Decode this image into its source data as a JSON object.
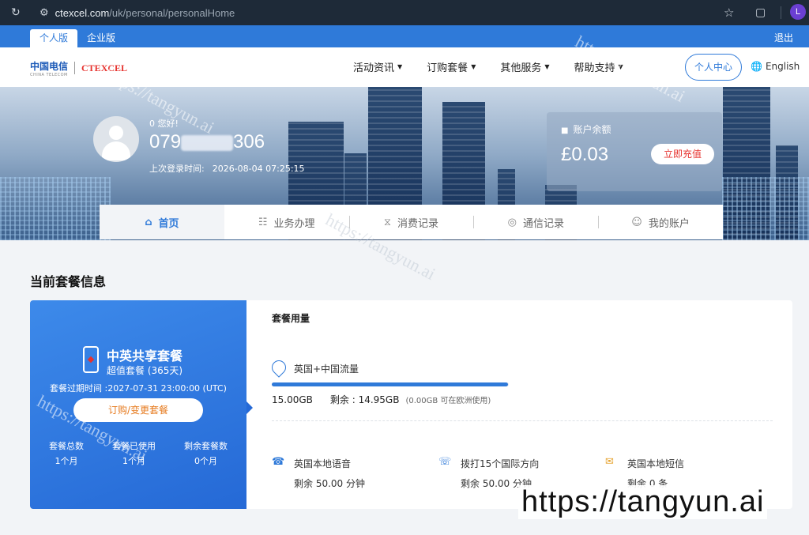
{
  "browser": {
    "url_host": "ctexcel.com",
    "url_path": "/uk/personal/personalHome",
    "profile_initial": "L"
  },
  "top_strip": {
    "tabs": [
      {
        "label": "个人版"
      },
      {
        "label": "企业版"
      }
    ],
    "logout": "退出"
  },
  "header": {
    "logo_ct": "中国电信",
    "logo_ct_sub": "CHINA TELECOM",
    "logo_cte": "CTEXCEL",
    "nav": [
      {
        "label": "活动资讯"
      },
      {
        "label": "订购套餐"
      },
      {
        "label": "其他服务"
      },
      {
        "label": "帮助支持"
      }
    ],
    "personal_center": "个人中心",
    "language": "English"
  },
  "user": {
    "greeting": "0 您好!",
    "phone_prefix": "079",
    "phone_suffix": "306",
    "last_login_label": "上次登录时间:",
    "last_login_time": "2026-08-04 07:25:15"
  },
  "balance": {
    "label": "账户余额",
    "amount": "£0.03",
    "recharge": "立即充值"
  },
  "tabs": [
    {
      "label": "首页",
      "icon": "home-icon"
    },
    {
      "label": "业务办理",
      "icon": "document-icon"
    },
    {
      "label": "消费记录",
      "icon": "receipt-icon"
    },
    {
      "label": "通信记录",
      "icon": "signal-icon"
    },
    {
      "label": "我的账户",
      "icon": "user-icon"
    }
  ],
  "section": {
    "title": "当前套餐信息"
  },
  "plan": {
    "name": "中英共享套餐",
    "subtitle": "超值套餐 (365天)",
    "expiry": "套餐过期时间 :2027-07-31 23:00:00 (UTC)",
    "button": "订购/变更套餐",
    "stats": [
      {
        "label": "套餐总数",
        "value": "1个月"
      },
      {
        "label": "套餐已使用",
        "value": "1个月"
      },
      {
        "label": "剩余套餐数",
        "value": "0个月"
      }
    ]
  },
  "usage": {
    "title": "套餐用量",
    "data": {
      "label": "英国+中国流量",
      "total": "15.00GB",
      "remaining": "剩余 : 14.95GB",
      "note": "(0.00GB 可在欧洲使用)",
      "remaining_fraction": 0.997
    },
    "services": [
      {
        "label": "英国本地语音",
        "value": "剩余 50.00 分钟",
        "icon": "phone-icon"
      },
      {
        "label": "拨打15个国际方向",
        "value": "剩余 50.00 分钟",
        "icon": "international-call-icon"
      },
      {
        "label": "英国本地短信",
        "value": "剩余 0 条",
        "icon": "mail-icon"
      }
    ]
  },
  "watermark": "https://tangyun.ai",
  "colors": {
    "brand": "#2f7ad9",
    "accent_red": "#e6322e",
    "accent_orange": "#e67a1e"
  }
}
